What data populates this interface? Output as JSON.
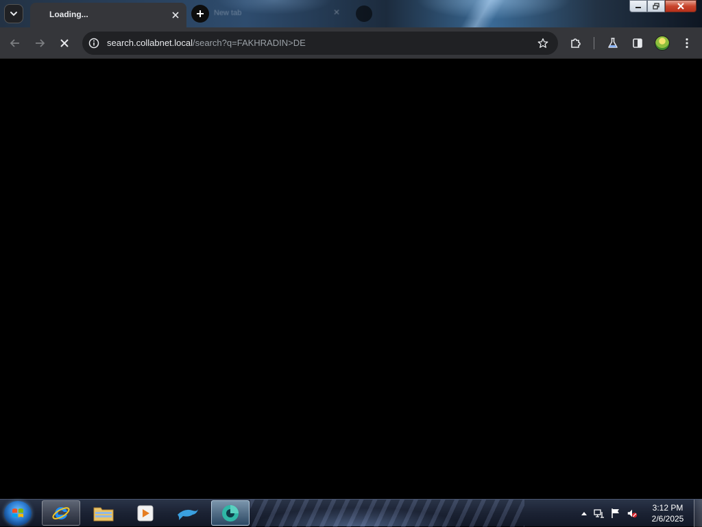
{
  "browser": {
    "active_tab": {
      "title": "Loading..."
    },
    "background_tab": {
      "title": "New tab"
    },
    "address_bar": {
      "host": "search.collabnet.local",
      "path": "/search?q=FAKHRADIN>DE"
    },
    "icons": {
      "tab_search": "chevron-down-icon",
      "tab_close": "close-icon",
      "new_tab": "plus-icon",
      "back": "arrow-left-icon",
      "forward": "arrow-right-icon",
      "stop": "close-icon",
      "site_info": "info-icon",
      "bookmark": "star-icon",
      "extensions": "puzzle-icon",
      "labs": "flask-icon",
      "side_panel": "side-panel-icon",
      "menu": "kebab-menu-icon"
    },
    "colors": {
      "toolbar": "#35363a",
      "omnibox": "#202124",
      "content": "#000000"
    }
  },
  "window_controls": {
    "minimize": "minimize-icon",
    "maximize": "restore-icon",
    "close": "close-icon"
  },
  "taskbar": {
    "apps": [
      "internet-explorer",
      "file-explorer",
      "media-player",
      "dolphin-app",
      "browser"
    ],
    "clock": {
      "time": "3:12 PM",
      "date": "2/6/2025"
    }
  }
}
